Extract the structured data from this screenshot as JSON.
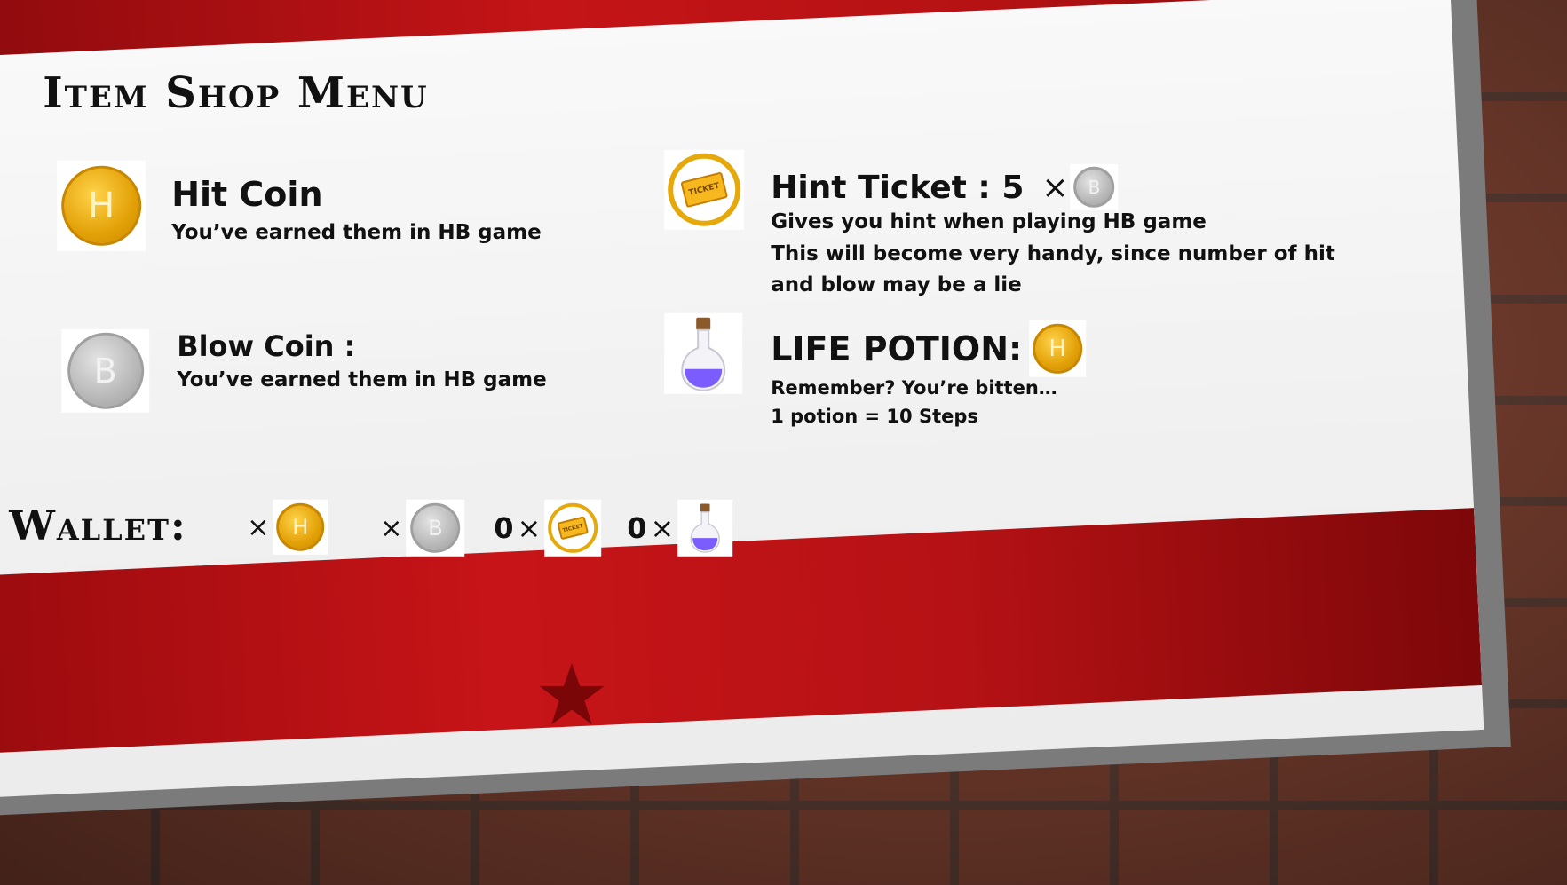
{
  "title": "Item Shop Menu",
  "items": {
    "hit_coin": {
      "name": "Hit Coin",
      "desc": "You’ve earned them in HB game",
      "icon": "hit-coin-icon",
      "letter": "H"
    },
    "blow_coin": {
      "name": "Blow Coin :",
      "desc": "You’ve earned them in HB game",
      "icon": "blow-coin-icon",
      "letter": "B"
    },
    "hint_ticket": {
      "name": "Hint Ticket : 5",
      "times": "×",
      "price_icon": "blow-coin-icon",
      "desc_lines": [
        "Gives you hint when playing HB game",
        "This will become very handy, since number of hit",
        "and blow may be a lie"
      ],
      "icon": "ticket-icon",
      "ticket_text": "TICKET"
    },
    "life_potion": {
      "name": "LIFE POTION:",
      "price_icon": "hit-coin-icon",
      "desc_lines": [
        "Remember? You’re bitten…",
        "1 potion = 10 Steps"
      ],
      "icon": "potion-icon"
    }
  },
  "wallet": {
    "label": "Wallet:",
    "hit_count": "",
    "blow_count": "",
    "ticket_count": "0",
    "potion_count": "0",
    "times": "×"
  },
  "colors": {
    "red_band": "#c41417",
    "gold": "#e3a108",
    "silver": "#b8b8b8",
    "potion": "#7b5cff"
  },
  "decor": {
    "star_icon": "star-icon"
  }
}
